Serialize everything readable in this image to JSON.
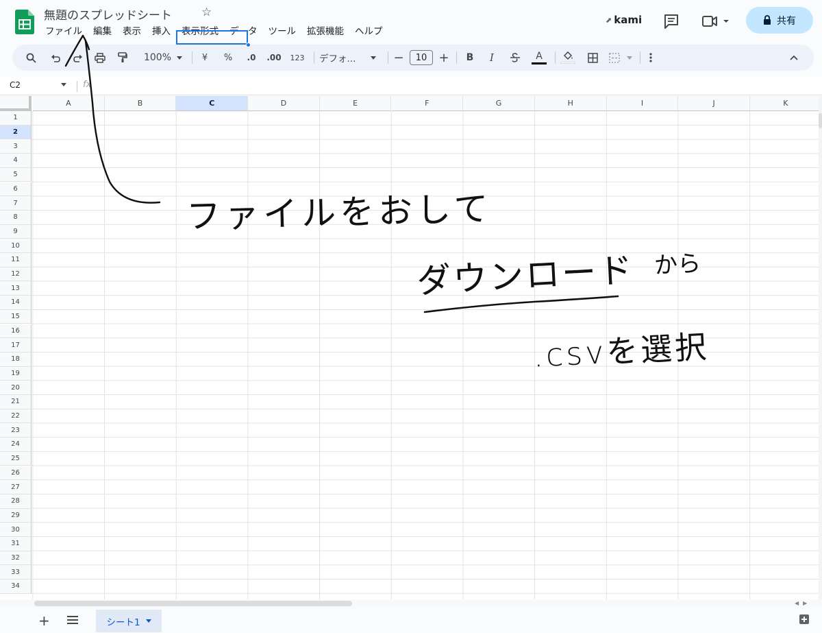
{
  "app": {
    "title": "無題のスプレッドシート",
    "star_icon": "star-outline-icon",
    "brand_color": "#0f9d58"
  },
  "menu": [
    "ファイル",
    "編集",
    "表示",
    "挿入",
    "表示形式",
    "データ",
    "ツール",
    "拡張機能",
    "ヘルプ"
  ],
  "account": {
    "name": "kami",
    "share_label": "共有"
  },
  "toolbar": {
    "zoom": "100%",
    "currency": "¥",
    "percent": "%",
    "decrease_decimal": ".0",
    "increase_decimal": ".00",
    "number_format": "123",
    "font": "デフォ...",
    "font_size": "10",
    "bold": "B",
    "italic": "I",
    "text_color_letter": "A"
  },
  "formula_bar": {
    "cell_ref": "C2",
    "fx": "fx",
    "value": ""
  },
  "grid": {
    "columns": [
      "A",
      "B",
      "C",
      "D",
      "E",
      "F",
      "G",
      "H",
      "I",
      "J",
      "K"
    ],
    "rows": [
      "1",
      "2",
      "3",
      "4",
      "5",
      "6",
      "7",
      "8",
      "9",
      "10",
      "11",
      "12",
      "13",
      "14",
      "15",
      "16",
      "17",
      "18",
      "19",
      "20",
      "21",
      "22",
      "23",
      "24",
      "25",
      "26",
      "27",
      "28",
      "29",
      "30",
      "31",
      "32",
      "33",
      "34"
    ],
    "selected_column": "C",
    "selected_row": "2",
    "selection_color": "#1a73e8"
  },
  "sheets": {
    "tabs": [
      "シート1"
    ],
    "active": "シート1"
  },
  "handwriting": {
    "line1": "ファイルをおして",
    "line2_underlined": "ダウンロード",
    "line2_suffix": "から",
    "line3": ".csvを選択"
  }
}
